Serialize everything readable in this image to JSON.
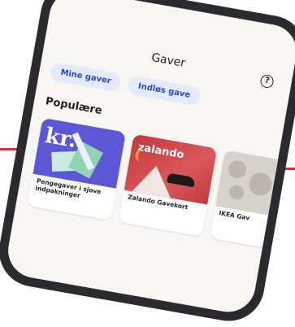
{
  "app": {
    "title": "Gaver"
  },
  "header": {
    "help_icon": "help-circle-icon"
  },
  "tabs": [
    {
      "label": "Mine gaver"
    },
    {
      "label": "Indløs gave"
    }
  ],
  "section": {
    "title": "Populære"
  },
  "cards": [
    {
      "label": "Pengegaver i sjove indpakninger",
      "image_text": "kr."
    },
    {
      "label": "Zalando Gavekort",
      "image_text": "zalando"
    },
    {
      "label": "IKEA Gav"
    }
  ],
  "colors": {
    "accent": "#2d48d8",
    "pill_bg": "#e3eafc",
    "red_line": "#e8262e"
  }
}
